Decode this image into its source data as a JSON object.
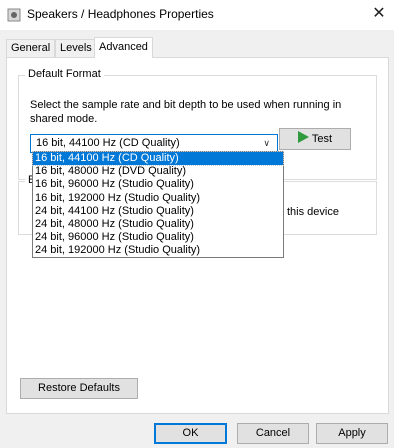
{
  "window": {
    "title": "Speakers / Headphones Properties",
    "close_glyph": "✕"
  },
  "tabs": [
    {
      "label": "General"
    },
    {
      "label": "Levels"
    },
    {
      "label": "Advanced",
      "active": true
    }
  ],
  "default_format": {
    "group_label": "Default Format",
    "description": "Select the sample rate and bit depth to be used when running in shared mode.",
    "selected": "16 bit, 44100 Hz (CD Quality)",
    "test_label": "Test",
    "options": [
      "16 bit, 44100 Hz (CD Quality)",
      "16 bit, 48000 Hz (DVD Quality)",
      "16 bit, 96000 Hz (Studio Quality)",
      "16 bit, 192000 Hz (Studio Quality)",
      "24 bit, 44100 Hz (Studio Quality)",
      "24 bit, 48000 Hz (Studio Quality)",
      "24 bit, 96000 Hz (Studio Quality)",
      "24 bit, 192000 Hz (Studio Quality)"
    ]
  },
  "exclusive_mode": {
    "label_fragment": "E",
    "text_fragment": "this device"
  },
  "restore_defaults_label": "Restore Defaults",
  "footer": {
    "ok": "OK",
    "cancel": "Cancel",
    "apply": "Apply"
  },
  "colors": {
    "accent": "#0078d7",
    "test_icon": "#2e9a3c"
  }
}
